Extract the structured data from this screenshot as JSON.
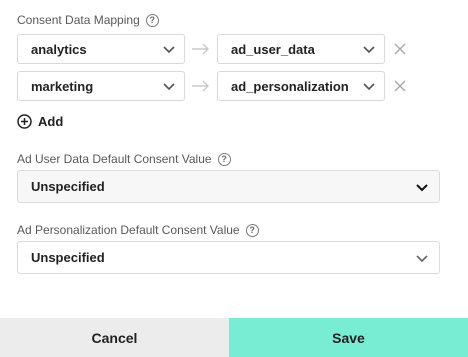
{
  "mapping": {
    "title": "Consent Data Mapping",
    "help_glyph": "?",
    "rows": [
      {
        "source": "analytics",
        "target": "ad_user_data"
      },
      {
        "source": "marketing",
        "target": "ad_personalization"
      }
    ],
    "add_label": "Add"
  },
  "ad_user_data_default": {
    "label": "Ad User Data Default Consent Value",
    "value": "Unspecified"
  },
  "ad_personalization_default": {
    "label": "Ad Personalization Default Consent Value",
    "value": "Unspecified"
  },
  "footer": {
    "cancel_label": "Cancel",
    "save_label": "Save"
  },
  "colors": {
    "save_bg": "#79ecd4",
    "cancel_bg": "#ececec"
  }
}
